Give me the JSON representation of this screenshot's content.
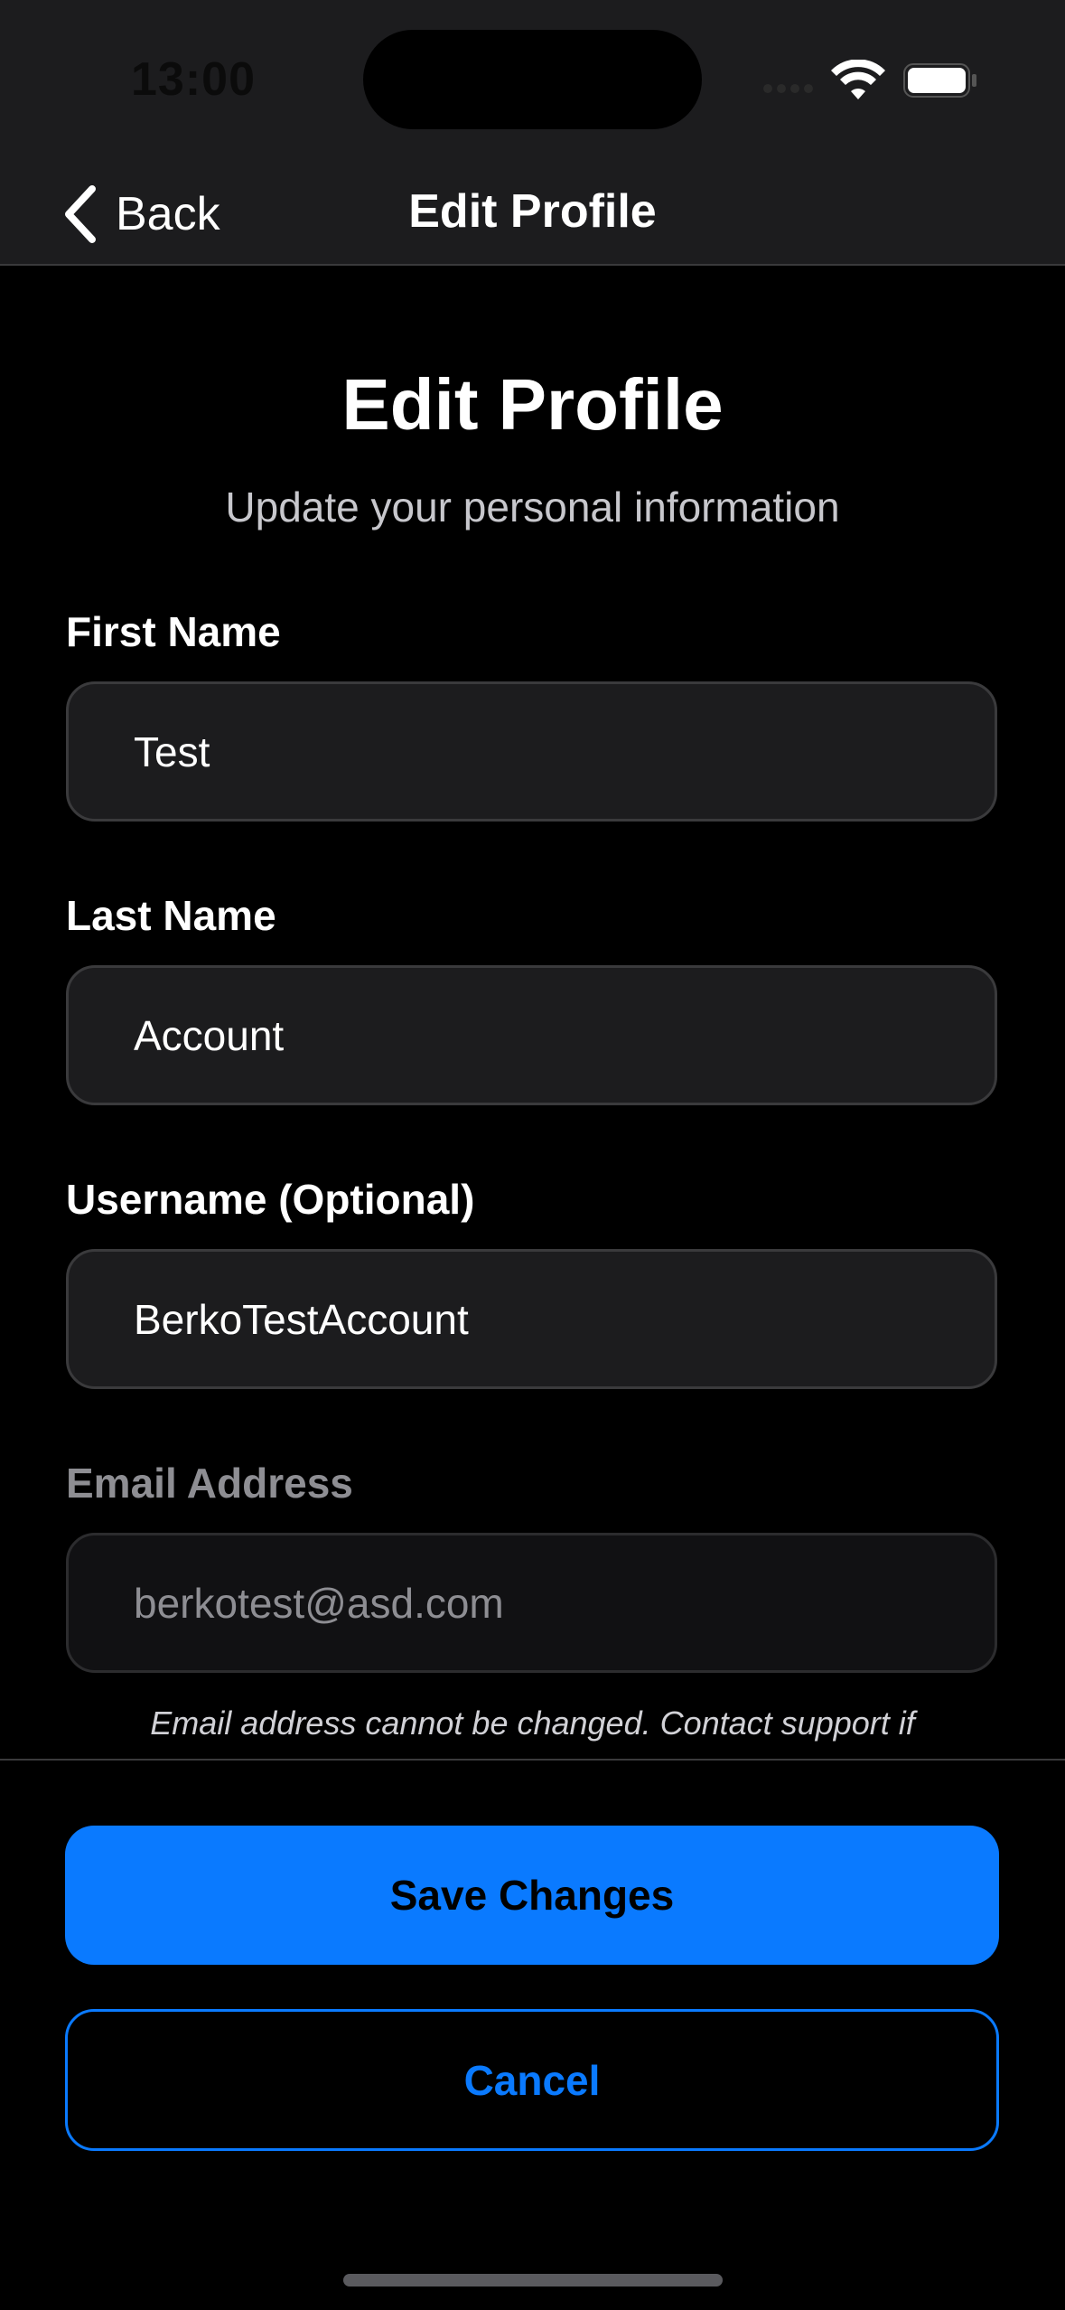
{
  "status_bar": {
    "time": "13:00",
    "icons": [
      "signal-icon",
      "wifi-icon",
      "battery-icon"
    ]
  },
  "nav": {
    "back_label": "Back",
    "back_icon": "chevron-left-icon",
    "title": "Edit Profile"
  },
  "header": {
    "title": "Edit Profile",
    "subtitle": "Update your personal information"
  },
  "form": {
    "first_name": {
      "label": "First Name",
      "value": "Test"
    },
    "last_name": {
      "label": "Last Name",
      "value": "Account"
    },
    "username": {
      "label": "Username (Optional)",
      "value": "BerkoTestAccount"
    },
    "email": {
      "label": "Email Address",
      "value": "berkotest@asd.com"
    },
    "email_helper": "Email address cannot be changed. Contact support if"
  },
  "actions": {
    "save_label": "Save Changes",
    "cancel_label": "Cancel"
  },
  "colors": {
    "accent": "#0a7aff",
    "background": "#000000",
    "surface": "#1c1c1e"
  }
}
